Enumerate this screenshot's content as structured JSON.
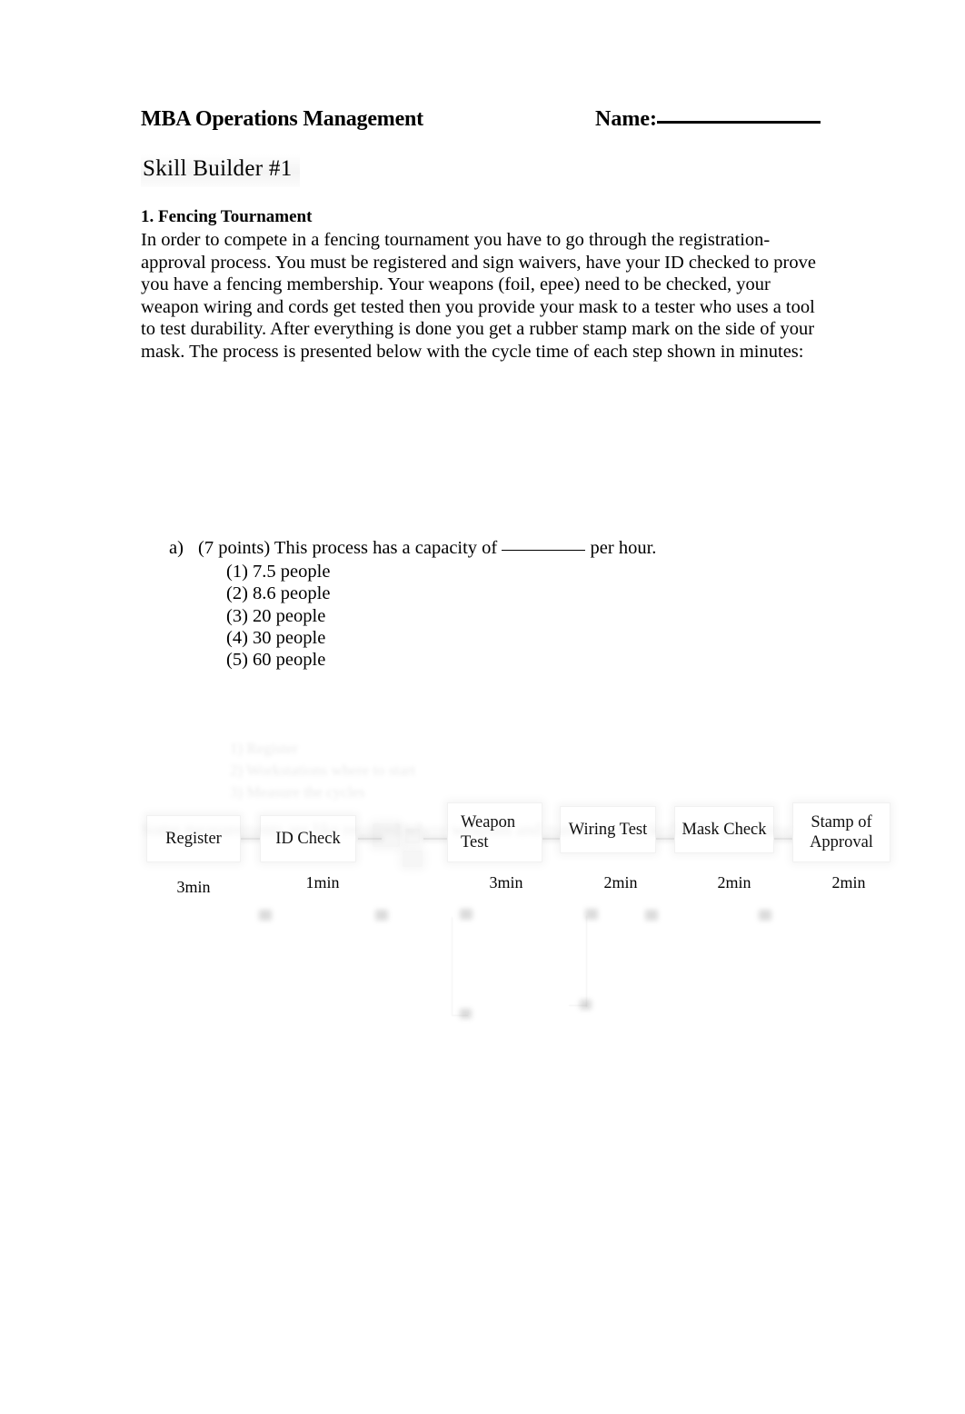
{
  "header": {
    "course_title": "MBA Operations Management",
    "name_label": "Name:",
    "subtitle": "Skill Builder  #1"
  },
  "problem": {
    "heading": "1. Fencing Tournament",
    "body": "In order to compete in a fencing tournament you have to go through the registration-approval process. You must be registered and sign waivers, have your ID checked to prove you have a fencing membership. Your weapons (foil, epee) need to be checked, your weapon wiring and cords get tested then you provide your mask to a tester who uses a tool to test durability. After everything is done you get a rubber stamp mark on the side of your mask. The process is presented below with the cycle time of each step shown in minutes:"
  },
  "process_flow": {
    "steps": [
      {
        "label": "Register",
        "time": "3min"
      },
      {
        "label": "ID Check",
        "time": "1min"
      },
      {
        "label": "Weapon Test",
        "time": "3min"
      },
      {
        "label": "Wiring Test",
        "time": "2min"
      },
      {
        "label": "Mask Check",
        "time": "2min"
      },
      {
        "label": "Stamp of Approval",
        "time": "2min"
      }
    ]
  },
  "question_a": {
    "letter": "a)",
    "points": "(7 points)",
    "stem_before": "This process has a capacity of",
    "stem_after": "per hour.",
    "options": [
      "(1) 7.5 people",
      "(2) 8.6 people",
      "(3) 20 people",
      "(4) 30 people",
      "(5) 60 people"
    ]
  },
  "faded_region": {
    "note": "illegible faded content",
    "lines": [
      "1) Register",
      "2) Workstations where to start",
      "3) Measure the cycles"
    ],
    "paragraph": "Some measurements are like required where weapons and masks are checked at the same time"
  },
  "colors": {
    "text": "#000000",
    "page_background": "#ffffff",
    "highlight": "#ebebeb",
    "faint_outline": "rgba(0,0,0,0.055)"
  }
}
